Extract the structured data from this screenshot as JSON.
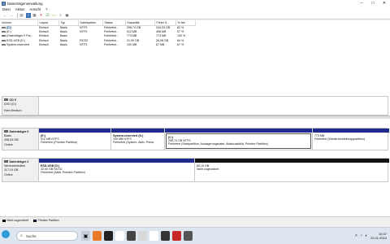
{
  "window": {
    "title": "Datenträgerverwaltung",
    "minimize": "–",
    "maximize": "□",
    "close": "✕"
  },
  "menu": [
    "Datei",
    "Aktion",
    "Ansicht",
    "?"
  ],
  "toolbar": [
    "back-icon",
    "forward-icon",
    "list-icon",
    "help-icon",
    "properties-icon",
    "delete-icon",
    "check-icon",
    "open-icon",
    "search-icon",
    "view-icon"
  ],
  "volumes": {
    "headers": [
      "Volume",
      "Layout",
      "Typ",
      "Dateisystem",
      "Status",
      "Kapazität",
      "Freier S...",
      "% frei"
    ],
    "rows": [
      [
        "(C:)",
        "Einfach",
        "Basis",
        "NTFS",
        "Fehlerfrei...",
        "298,74 GB",
        "244,93 GB",
        "82 %"
      ],
      [
        "(E:)",
        "Einfach",
        "Basis",
        "NTFS",
        "Fehlerfrei...",
        "512 MB",
        "498 MB",
        "97 %"
      ],
      [
        "(Datenträger 0 Par...",
        "Einfach",
        "Basis",
        "",
        "Fehlerfrei...",
        "773 MB",
        "773 MB",
        "100 %"
      ],
      [
        "ESD-USB (D:)",
        "Einfach",
        "Basis",
        "FAT32",
        "Fehlerfrei...",
        "31,99 GB",
        "26,98 GB",
        "84 %"
      ],
      [
        "System-reserviert",
        "Einfach",
        "Basis",
        "NTFS",
        "Fehlerfrei...",
        "100 MB",
        "67 MB",
        "67 %"
      ]
    ]
  },
  "disks": [
    {
      "name": "CD 0",
      "line2": "DVD (G:)",
      "line3": "",
      "line4": "Kein Medium",
      "partitions": []
    },
    {
      "name": "Datenträger 0",
      "line2": "Basis",
      "line3": "298,09 GB",
      "line4": "Online",
      "partitions": [
        {
          "title": "(E:)",
          "size": "512 MB NTFS",
          "status": "Fehlerfrei (Primäre Partition)"
        },
        {
          "title": "System-reserviert  (S:)",
          "size": "100 MB NTFS",
          "status": "Fehlerfrei (System, Aktiv, Prima"
        },
        {
          "title": "(C:)",
          "size": "298,74 GB NTFS",
          "status": "Fehlerfrei (Startpartition, Auslagerungsdatei, Absturzabbild, Primäre Partition)"
        },
        {
          "title": "",
          "size": "773 MB",
          "status": "Fehlerfrei (Wiederherstellungspartition)"
        }
      ]
    },
    {
      "name": "Datenträger 2",
      "line2": "Wechselmedien",
      "line3": "117,19 GB",
      "line4": "Online",
      "partitions": [
        {
          "title": "ESD-USB  (D:)",
          "size": "32,00 GB FAT32",
          "status": "Fehlerfrei (Aktiv, Primäre Partition)"
        },
        {
          "title": "",
          "size": "85,19 GB",
          "status": "Nicht zugeordnet"
        }
      ]
    }
  ],
  "legend": [
    {
      "label": "Nicht zugeordnet",
      "color": "#111111"
    },
    {
      "label": "Primäre Partition",
      "color": "#1f2a8c"
    }
  ],
  "taskbar": {
    "search": "Suche",
    "time": "10:47",
    "date": "22.01.2024"
  }
}
